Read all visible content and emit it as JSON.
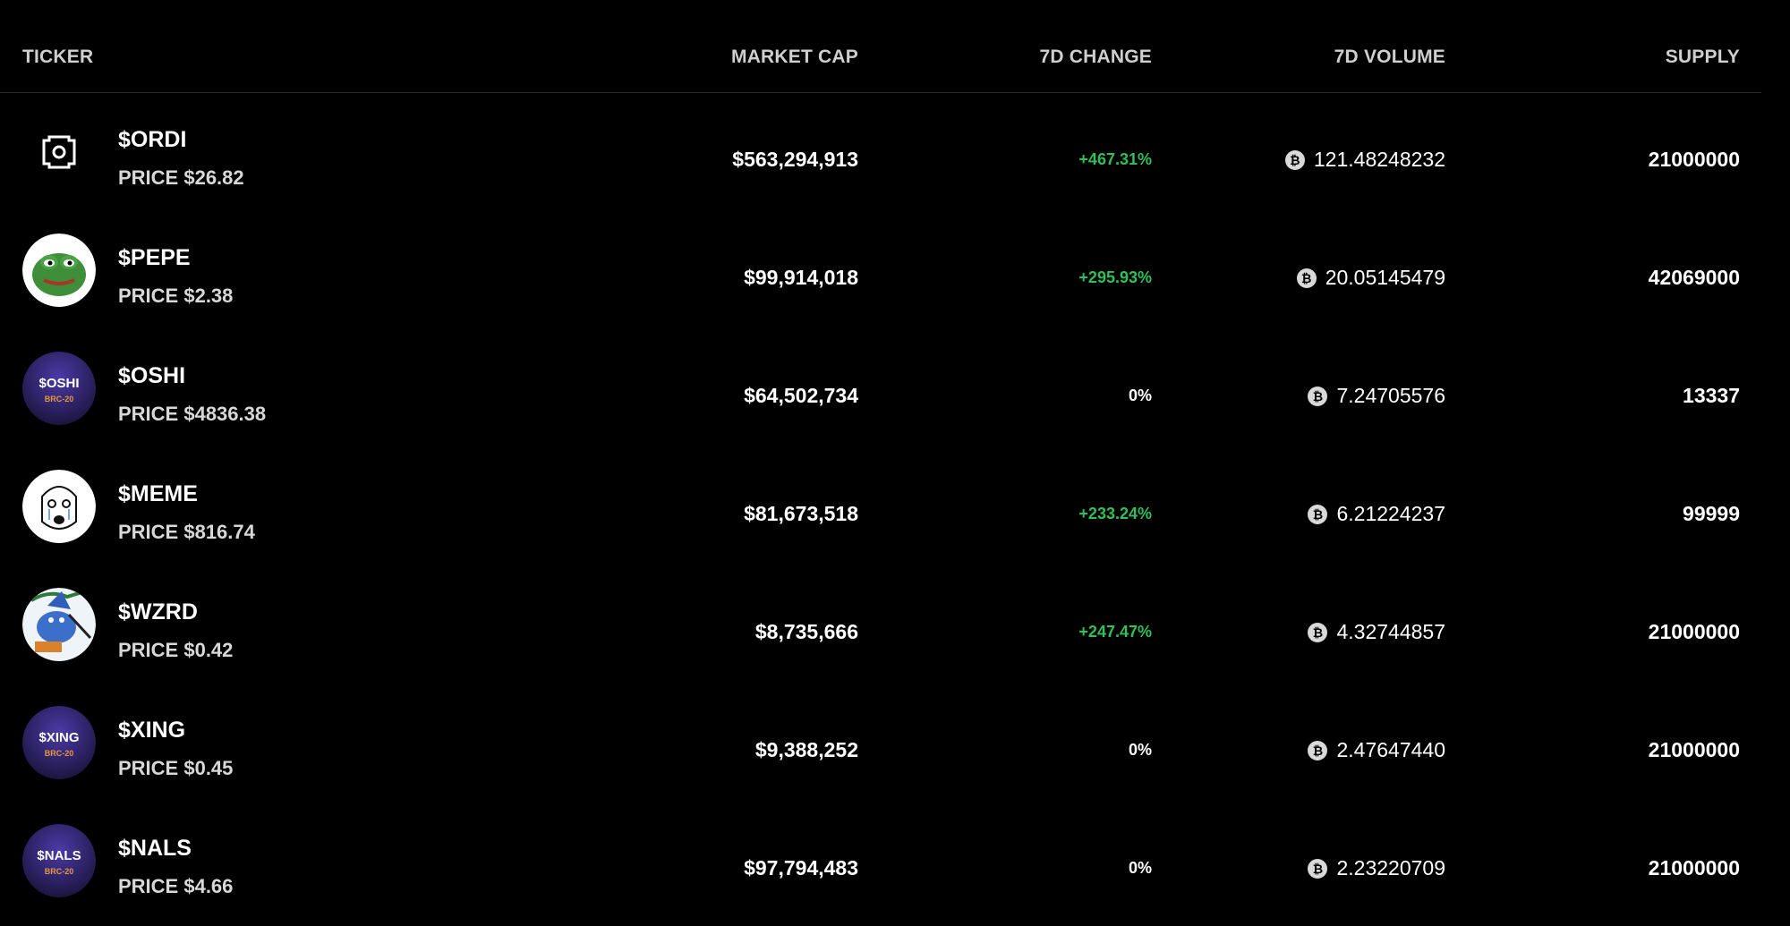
{
  "header": {
    "ticker": "TICKER",
    "market_cap": "MARKET CAP",
    "change_7d": "7D CHANGE",
    "volume_7d": "7D VOLUME",
    "supply": "SUPPLY"
  },
  "colors": {
    "background": "#000000",
    "positive": "#2fbf5b",
    "divider": "#2a2a2a"
  },
  "rows": [
    {
      "ticker": "$ORDI",
      "price": "PRICE $26.82",
      "market_cap": "$563,294,913",
      "change": "+467.31%",
      "change_state": "positive",
      "volume": "121.48248232",
      "supply": "21000000",
      "icon": "ordi-logo-icon"
    },
    {
      "ticker": "$PEPE",
      "price": "PRICE $2.38",
      "market_cap": "$99,914,018",
      "change": "+295.93%",
      "change_state": "positive",
      "volume": "20.05145479",
      "supply": "42069000",
      "icon": "pepe-frog-avatar"
    },
    {
      "ticker": "$OSHI",
      "price": "PRICE $4836.38",
      "market_cap": "$64,502,734",
      "change": "0%",
      "change_state": "zero",
      "volume": "7.24705576",
      "supply": "13337",
      "icon": "brc20-badge-icon",
      "badge_text": "$OSHI",
      "badge_sub": "BRC-20"
    },
    {
      "ticker": "$MEME",
      "price": "PRICE $816.74",
      "market_cap": "$81,673,518",
      "change": "+233.24%",
      "change_state": "positive",
      "volume": "6.21224237",
      "supply": "99999",
      "icon": "meme-wojak-avatar"
    },
    {
      "ticker": "$WZRD",
      "price": "PRICE $0.42",
      "market_cap": "$8,735,666",
      "change": "+247.47%",
      "change_state": "positive",
      "volume": "4.32744857",
      "supply": "21000000",
      "icon": "wizard-avatar"
    },
    {
      "ticker": "$XING",
      "price": "PRICE $0.45",
      "market_cap": "$9,388,252",
      "change": "0%",
      "change_state": "zero",
      "volume": "2.47647440",
      "supply": "21000000",
      "icon": "brc20-badge-icon",
      "badge_text": "$XING",
      "badge_sub": "BRC-20"
    },
    {
      "ticker": "$NALS",
      "price": "PRICE $4.66",
      "market_cap": "$97,794,483",
      "change": "0%",
      "change_state": "zero",
      "volume": "2.23220709",
      "supply": "21000000",
      "icon": "brc20-badge-icon",
      "badge_text": "$NALS",
      "badge_sub": "BRC-20"
    }
  ]
}
